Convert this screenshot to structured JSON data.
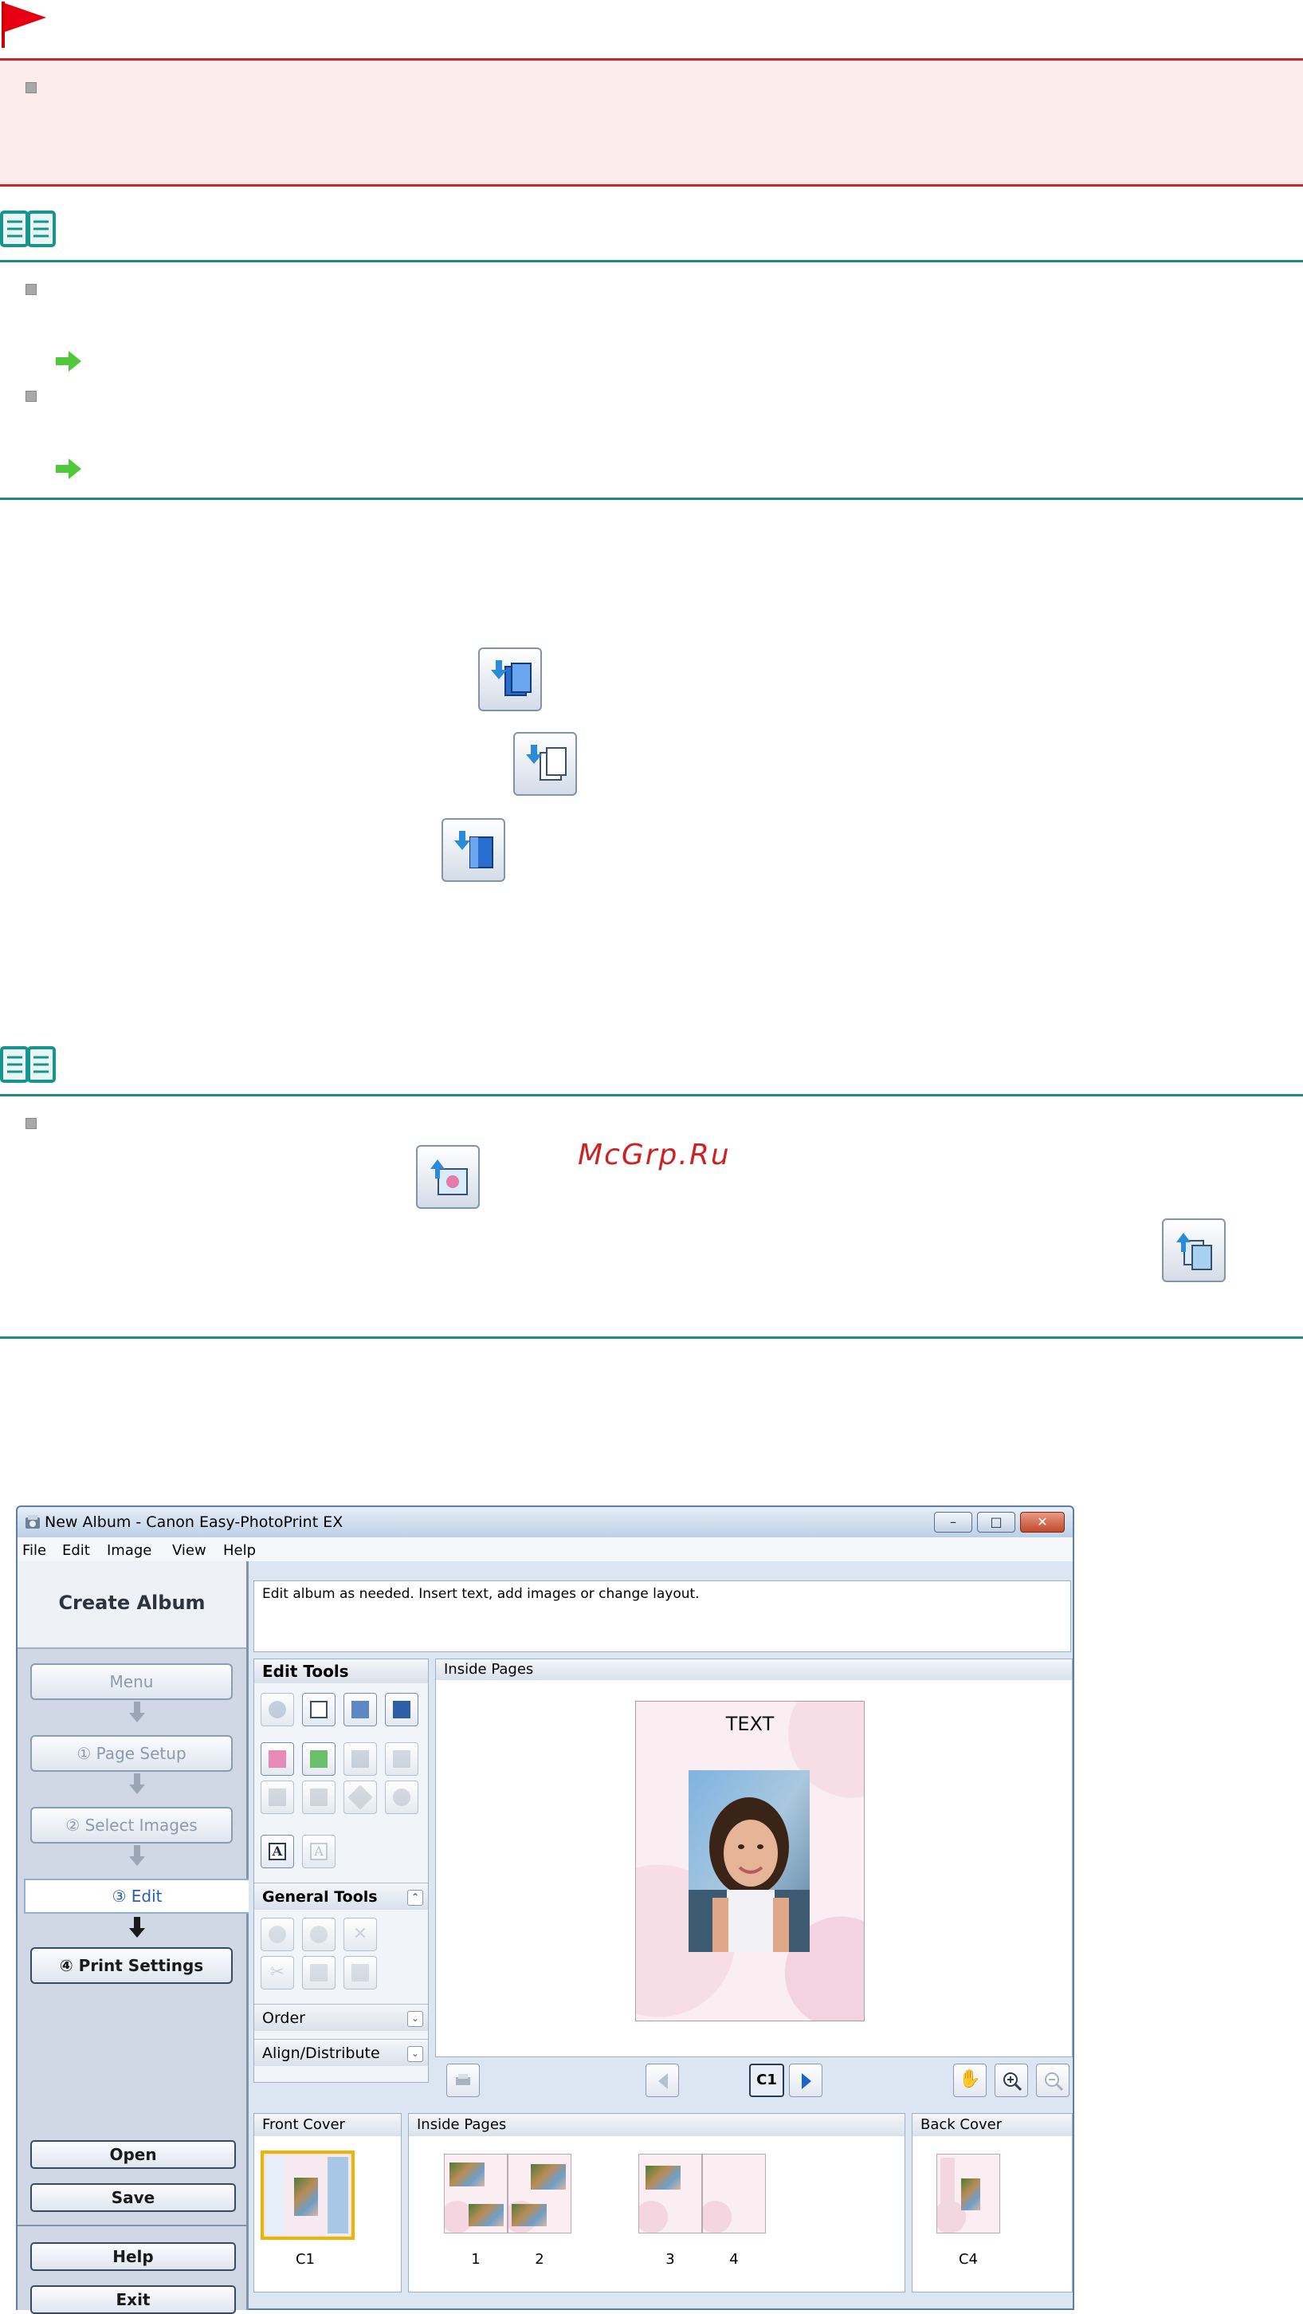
{
  "watermark": "McGrp.Ru",
  "window": {
    "title": "New Album - Canon Easy-PhotoPrint EX",
    "menu": [
      "File",
      "Edit",
      "Image",
      "View",
      "Help"
    ],
    "buttons": {
      "minimize": "–",
      "maximize": "□",
      "close": "✕"
    }
  },
  "sidebar": {
    "title": "Create Album",
    "steps": {
      "menu": "Menu",
      "page_setup": "① Page Setup",
      "select_images": "② Select Images",
      "edit": "③ Edit",
      "print_settings": "④ Print Settings"
    },
    "buttons": {
      "open": "Open",
      "save": "Save",
      "help": "Help",
      "exit": "Exit"
    }
  },
  "instruction": "Edit album as needed. Insert text, add images or change layout.",
  "tool_panel": {
    "edit_tools": "Edit Tools",
    "general_tools": "General Tools",
    "order": "Order",
    "align": "Align/Distribute"
  },
  "canvas": {
    "header": "Inside Pages",
    "page_text": "TEXT"
  },
  "nav": {
    "current_page": "C1"
  },
  "strips": {
    "front_cover": {
      "label": "Front Cover",
      "page": "C1"
    },
    "inside_pages": {
      "label": "Inside Pages",
      "pages": [
        "1",
        "2",
        "3",
        "4"
      ]
    },
    "back_cover": {
      "label": "Back Cover",
      "page": "C4"
    }
  }
}
